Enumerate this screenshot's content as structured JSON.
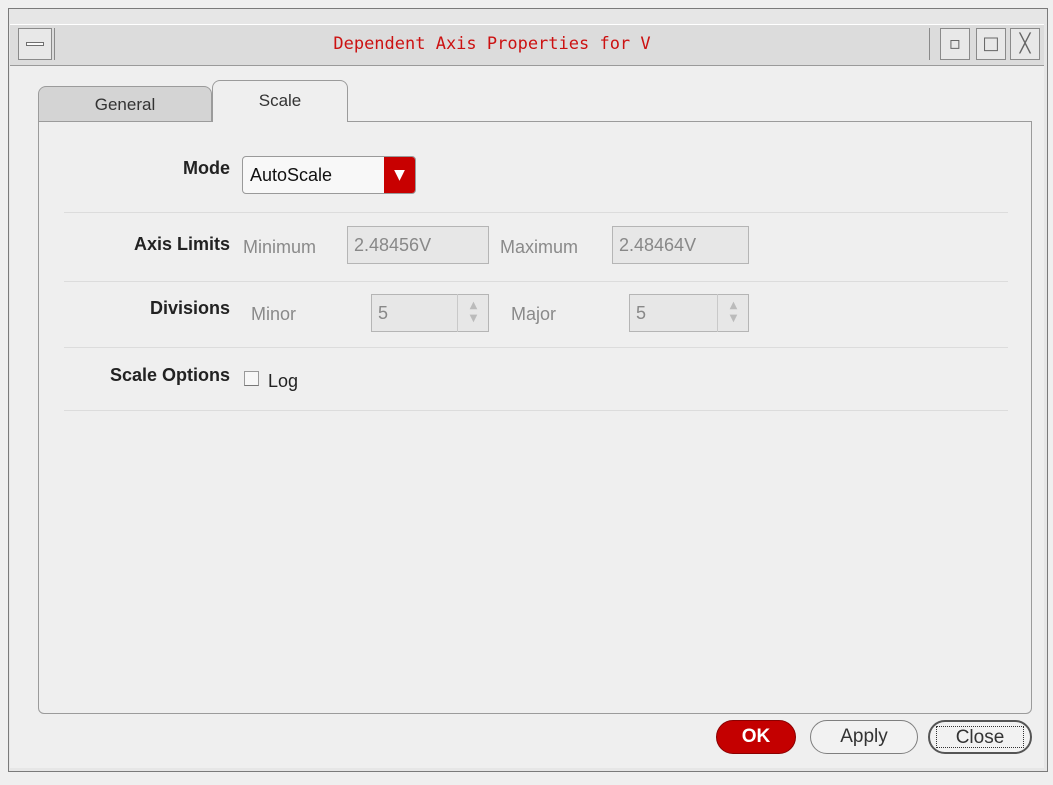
{
  "window": {
    "title": "Dependent Axis Properties for V",
    "controls": {
      "minimize": "▫",
      "maximize": "□",
      "close": "╳"
    }
  },
  "tabs": [
    {
      "label": "General",
      "active": false
    },
    {
      "label": "Scale",
      "active": true
    }
  ],
  "mode": {
    "label": "Mode",
    "value": "AutoScale"
  },
  "axis_limits": {
    "label": "Axis Limits",
    "minimum_label": "Minimum",
    "minimum_value": "2.48456V",
    "maximum_label": "Maximum",
    "maximum_value": "2.48464V"
  },
  "divisions": {
    "label": "Divisions",
    "minor_label": "Minor",
    "minor_value": "5",
    "major_label": "Major",
    "major_value": "5"
  },
  "scale_options": {
    "label": "Scale Options",
    "log_label": "Log",
    "log_checked": false
  },
  "buttons": {
    "ok": "OK",
    "apply": "Apply",
    "close": "Close"
  },
  "colors": {
    "accent": "#c80000",
    "title_text": "#cc1111"
  }
}
